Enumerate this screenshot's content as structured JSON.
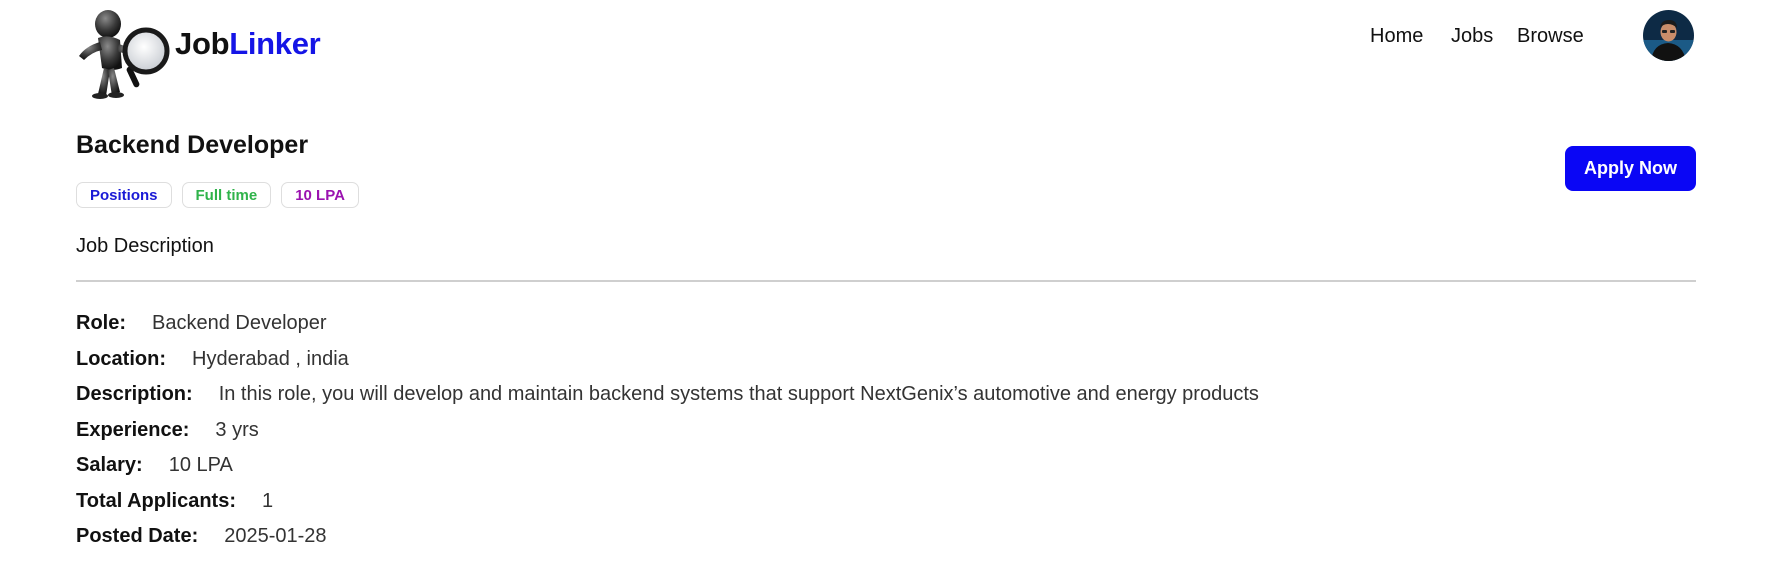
{
  "header": {
    "brand_part1": "Job",
    "brand_part2": "Linker",
    "nav": [
      {
        "label": "Home"
      },
      {
        "label": "Jobs"
      },
      {
        "label": "Browse"
      }
    ]
  },
  "job": {
    "title": "Backend Developer",
    "badges": [
      {
        "label": "Positions",
        "color": "#1a1ad6"
      },
      {
        "label": "Full time",
        "color": "#2fb34a"
      },
      {
        "label": "10 LPA",
        "color": "#9b12b0"
      }
    ],
    "apply_label": "Apply Now",
    "section_heading": "Job Description",
    "details": [
      {
        "label": "Role:",
        "value": "Backend Developer"
      },
      {
        "label": "Location:",
        "value": "Hyderabad , india"
      },
      {
        "label": "Description:",
        "value": "In this role, you will develop and maintain backend systems that support NextGenix’s automotive and energy products"
      },
      {
        "label": "Experience:",
        "value": "3 yrs"
      },
      {
        "label": "Salary:",
        "value": "10 LPA"
      },
      {
        "label": "Total Applicants:",
        "value": "1"
      },
      {
        "label": "Posted Date:",
        "value": "2025-01-28"
      }
    ]
  },
  "colors": {
    "brand_accent": "#1515e6",
    "apply_button": "#0a06f5"
  }
}
